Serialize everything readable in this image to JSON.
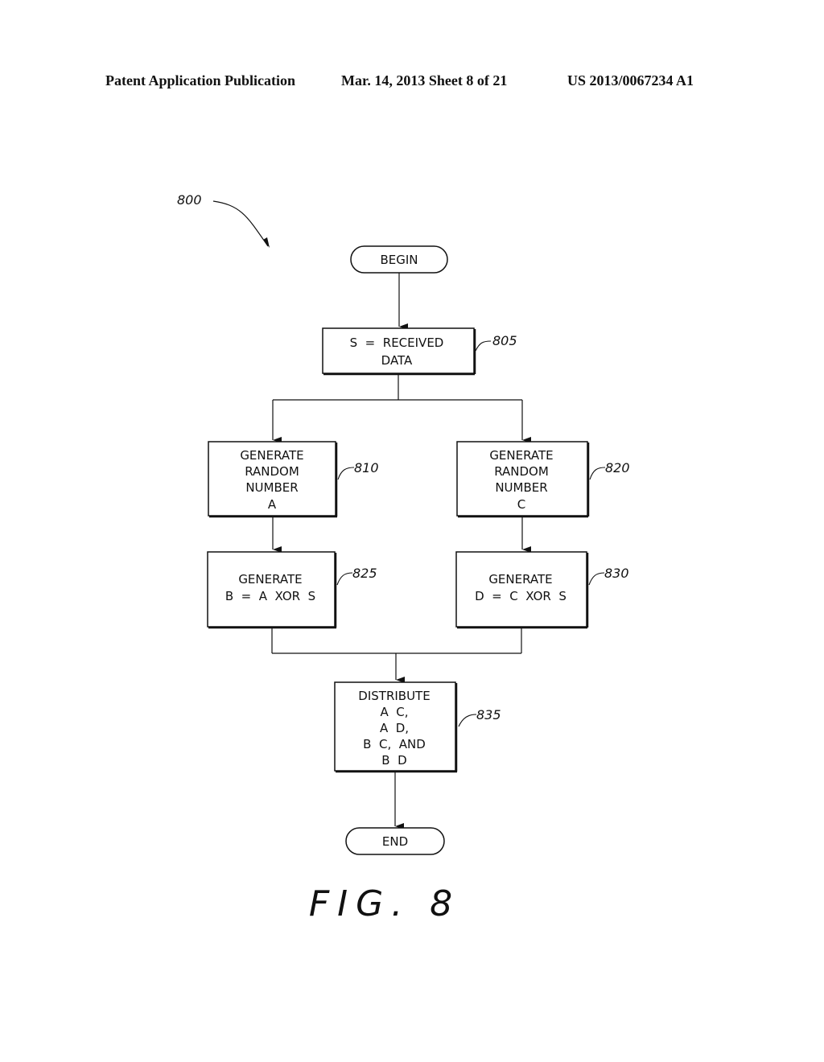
{
  "header": {
    "left": "Patent Application Publication",
    "center": "Mar. 14, 2013  Sheet 8 of 21",
    "right": "US 2013/0067234 A1"
  },
  "diagram": {
    "ref_main": "800",
    "begin": "BEGIN",
    "end": "END",
    "steps": {
      "s805": {
        "ref": "805",
        "lines": [
          "S  =  RECEIVED",
          "DATA"
        ]
      },
      "s810": {
        "ref": "810",
        "lines": [
          "GENERATE",
          "RANDOM",
          "NUMBER",
          "A"
        ]
      },
      "s820": {
        "ref": "820",
        "lines": [
          "GENERATE",
          "RANDOM",
          "NUMBER",
          "C"
        ]
      },
      "s825": {
        "ref": "825",
        "lines": [
          "GENERATE",
          "B  =  A  XOR  S"
        ]
      },
      "s830": {
        "ref": "830",
        "lines": [
          "GENERATE",
          "D  =  C  XOR  S"
        ]
      },
      "s835": {
        "ref": "835",
        "lines": [
          "DISTRIBUTE",
          "A  C,",
          "A  D,",
          "B  C,  AND",
          "B  D"
        ]
      }
    },
    "figure_label": "FIG. 8"
  }
}
